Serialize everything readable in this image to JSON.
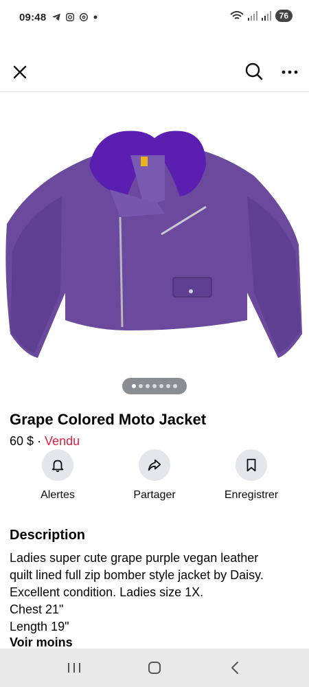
{
  "status_bar": {
    "time": "09:48",
    "left_icons": [
      "telegram-icon",
      "instagram-icon",
      "threads-icon",
      "dot-icon"
    ],
    "right_icons": [
      "wifi-icon",
      "signal-icon",
      "signal-icon"
    ],
    "battery": "76"
  },
  "top_bar": {
    "close_icon": "close-icon",
    "search_icon": "search-icon",
    "more_icon": "more-icon"
  },
  "listing": {
    "image_alt": "purple vegan leather moto jacket with purple faux fur collar",
    "carousel": {
      "total": 7,
      "active_index": 0
    },
    "title": "Grape Colored Moto Jacket",
    "price": "60 $",
    "separator": " · ",
    "status": "Vendu",
    "status_color": "#e41e3f"
  },
  "actions": [
    {
      "label": "Alertes",
      "icon": "bell-icon"
    },
    {
      "label": "Partager",
      "icon": "share-icon"
    },
    {
      "label": "Enregistrer",
      "icon": "bookmark-icon"
    }
  ],
  "description": {
    "heading": "Description",
    "lines": [
      "Ladies super cute grape purple vegan leather",
      "quilt lined full zip bomber style jacket by Daisy.",
      "Excellent condition. Ladies size 1X.",
      "Chest 21\"",
      "Length 19\""
    ],
    "toggle": "Voir moins"
  },
  "nav_bar": {
    "recents_icon": "recents-icon",
    "home_icon": "home-icon",
    "back_icon": "back-icon"
  },
  "colors": {
    "jacket_purple": "#6b4a9e",
    "fur_purple": "#5a1fb0",
    "action_circle": "#e4e6eb",
    "nav_bar": "#e9e9ea"
  }
}
